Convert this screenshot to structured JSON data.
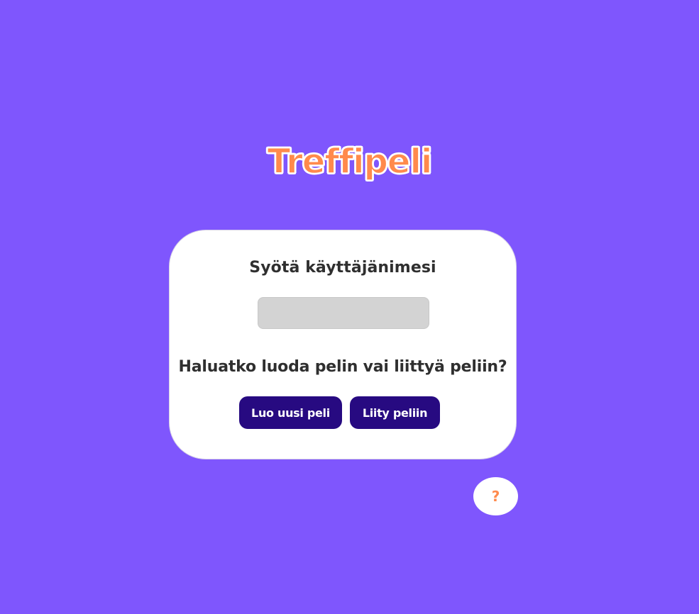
{
  "app": {
    "title": "Treffipeli"
  },
  "login_card": {
    "username_label": "Syötä käyttäjänimesi",
    "username_value": "",
    "username_placeholder": "",
    "question": "Haluatko luoda pelin vai liittyä peliin?",
    "create_button_label": "Luo uusi peli",
    "join_button_label": "Liity peliin"
  },
  "help": {
    "label": "?"
  },
  "colors": {
    "background": "#7f56fd",
    "title_orange": "#ff8a4c",
    "button_dark_purple": "#270a81",
    "card_white": "#ffffff",
    "input_gray": "#d3d3d3"
  }
}
